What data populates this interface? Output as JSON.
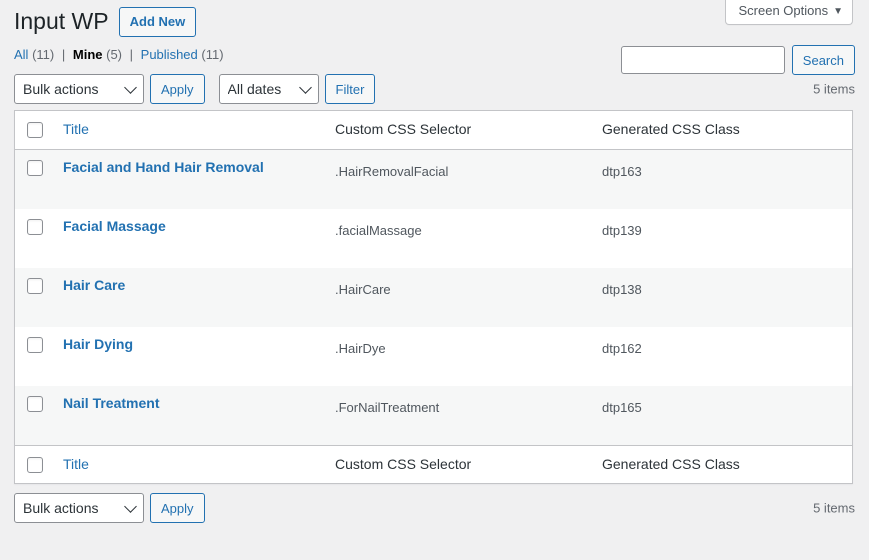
{
  "screen_meta": {
    "screen_options_label": "Screen Options",
    "arrow_glyph": "▼"
  },
  "header": {
    "title": "Input WP",
    "add_new_label": "Add New"
  },
  "search": {
    "value": "",
    "placeholder": "",
    "submit_label": "Search"
  },
  "views": [
    {
      "label": "All",
      "count": "(11)",
      "current": false
    },
    {
      "label": "Mine",
      "count": "(5)",
      "current": true
    },
    {
      "label": "Published",
      "count": "(11)",
      "current": false
    }
  ],
  "separator": "|",
  "tablenav_top": {
    "bulk_actions_selected": "Bulk actions",
    "bulk_actions_options": [
      "Bulk actions"
    ],
    "apply_label": "Apply",
    "dates_selected": "All dates",
    "dates_options": [
      "All dates"
    ],
    "filter_label": "Filter",
    "displaying_num": "5 items"
  },
  "tablenav_bottom": {
    "bulk_actions_selected": "Bulk actions",
    "bulk_actions_options": [
      "Bulk actions"
    ],
    "apply_label": "Apply",
    "displaying_num": "5 items"
  },
  "table": {
    "columns": {
      "title": "Title",
      "selector": "Custom CSS Selector",
      "class": "Generated CSS Class"
    },
    "rows": [
      {
        "title": "Facial and Hand Hair Removal",
        "selector": ".HairRemovalFacial",
        "css_class": "dtp163"
      },
      {
        "title": "Facial Massage",
        "selector": ".facialMassage",
        "css_class": "dtp139"
      },
      {
        "title": "Hair Care",
        "selector": ".HairCare",
        "css_class": "dtp138"
      },
      {
        "title": "Hair Dying",
        "selector": ".HairDye",
        "css_class": "dtp162"
      },
      {
        "title": "Nail Treatment",
        "selector": ".ForNailTreatment",
        "css_class": "dtp165"
      }
    ]
  },
  "colors": {
    "link": "#2271b1",
    "page_bg": "#f0f0f1",
    "row_alt_bg": "#f6f7f7",
    "border": "#c3c4c7"
  }
}
